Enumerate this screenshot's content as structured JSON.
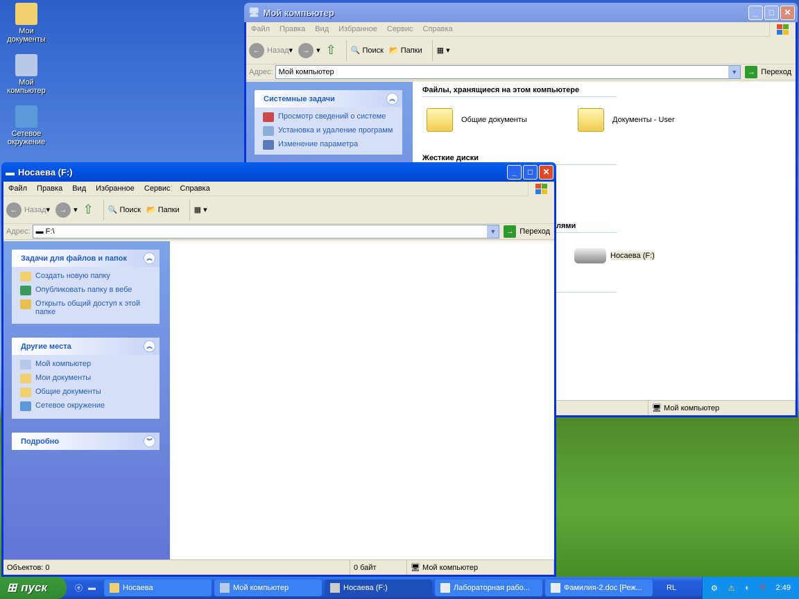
{
  "desktop": {
    "icons": [
      {
        "label": "Мои документы"
      },
      {
        "label": "Мой компьютер"
      },
      {
        "label": "Сетевое окружение"
      }
    ]
  },
  "back_window": {
    "title": "Мой компьютер",
    "menu": [
      "Файл",
      "Правка",
      "Вид",
      "Избранное",
      "Сервис",
      "Справка"
    ],
    "toolbar": {
      "back": "Назад",
      "search": "Поиск",
      "folders": "Папки"
    },
    "address_label": "Адрес:",
    "address": "Мой компьютер",
    "go": "Переход",
    "tasks_panel": {
      "title": "Системные задачи",
      "items": [
        "Просмотр сведений о системе",
        "Установка и удаление программ",
        "Изменение параметра"
      ]
    },
    "sections": [
      {
        "title": "Файлы, хранящиеся на этом компьютере",
        "items": [
          "Общие документы",
          "Документы - User"
        ]
      },
      {
        "title": "Жесткие диски"
      },
      {
        "title_partial": "лями",
        "items": [
          "Носаева (F:)"
        ]
      }
    ],
    "status": "Мой компьютер"
  },
  "front_window": {
    "title": "Носаева (F:)",
    "menu": [
      "Файл",
      "Правка",
      "Вид",
      "Избранное",
      "Сервис",
      "Справка"
    ],
    "toolbar": {
      "back": "Назад",
      "search": "Поиск",
      "folders": "Папки"
    },
    "address_label": "Адрес:",
    "address": "F:\\",
    "go": "Переход",
    "panels": [
      {
        "title": "Задачи для файлов и папок",
        "items": [
          "Создать новую папку",
          "Опубликовать папку в вебе",
          "Открыть общий доступ к этой папке"
        ]
      },
      {
        "title": "Другие места",
        "items": [
          "Мой компьютер",
          "Мои документы",
          "Общие документы",
          "Сетевое окружение"
        ]
      },
      {
        "title": "Подробно"
      }
    ],
    "status": {
      "objects": "Объектов: 0",
      "size": "0 байт",
      "location": "Мой компьютер"
    }
  },
  "taskbar": {
    "start": "пуск",
    "tasks": [
      "Носаева",
      "Мой компьютер",
      "Носаева (F:)",
      "Лабораторная рабо...",
      "Фамилия-2.doc [Реж..."
    ],
    "lang": "RL",
    "clock": "2:49"
  }
}
